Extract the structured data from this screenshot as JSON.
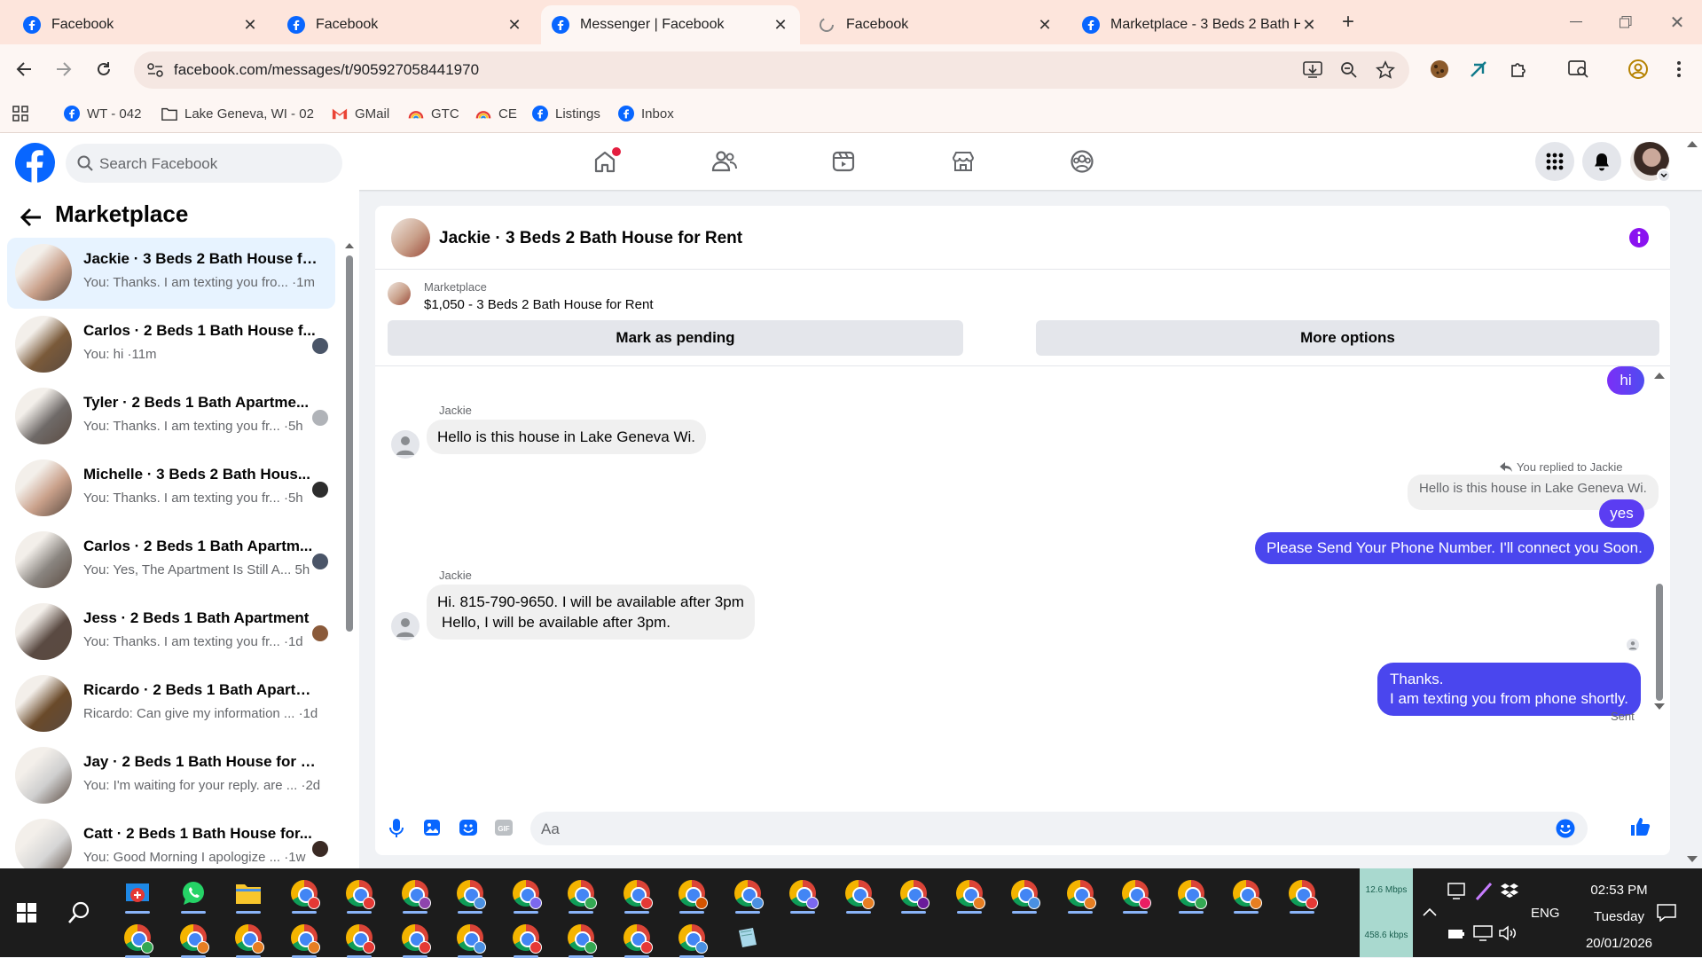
{
  "browser": {
    "tabs": [
      {
        "title": "Facebook",
        "icon": "facebook-icon",
        "active": false
      },
      {
        "title": "Facebook",
        "icon": "facebook-icon",
        "active": false
      },
      {
        "title": "Messenger | Facebook",
        "icon": "facebook-icon",
        "active": true
      },
      {
        "title": "Facebook",
        "icon": "loading-icon",
        "active": false
      },
      {
        "title": "Marketplace - 3 Beds 2 Bath Ho",
        "icon": "facebook-icon",
        "active": false
      }
    ],
    "url": "facebook.com/messages/t/905927058441970",
    "bookmarks": [
      {
        "label": "WT - 042",
        "icon": "facebook-icon"
      },
      {
        "label": "Lake Geneva, WI - 02",
        "icon": "folder-icon"
      },
      {
        "label": "GMail",
        "icon": "gmail-icon"
      },
      {
        "label": "GTC",
        "icon": "rainbow-icon"
      },
      {
        "label": "CE",
        "icon": "rainbow-icon"
      },
      {
        "label": "Listings",
        "icon": "facebook-icon"
      },
      {
        "label": "Inbox",
        "icon": "facebook-icon"
      }
    ]
  },
  "facebook": {
    "search_placeholder": "Search Facebook",
    "brand_color": "#0866ff"
  },
  "sidebar": {
    "title": "Marketplace",
    "conversations": [
      {
        "title": "Jackie · 3 Beds 2 Bath House for...",
        "preview": "You: Thanks. I am texting you fro... ·1m",
        "selected": true,
        "thumb": "#c9a08a"
      },
      {
        "title": "Carlos · 2 Beds 1 Bath House f...",
        "preview": "You: hi ·11m",
        "selected": false,
        "thumb": "#7a5a3a"
      },
      {
        "title": "Tyler · 2 Beds 1 Bath Apartme...",
        "preview": "You: Thanks. I am texting you fr... ·5h",
        "selected": false,
        "thumb": "#6f6a68"
      },
      {
        "title": "Michelle · 3 Beds 2 Bath Hous...",
        "preview": "You: Thanks. I am texting you fr... ·5h",
        "selected": false,
        "thumb": "#c9a08a"
      },
      {
        "title": "Carlos · 2 Beds 1 Bath Apartm...",
        "preview": "You: Yes, The Apartment Is Still A... 5h",
        "selected": false,
        "thumb": "#8a8580"
      },
      {
        "title": "Jess · 2 Beds 1 Bath Apartment",
        "preview": "You: Thanks. I am texting you fr... ·1d",
        "selected": false,
        "thumb": "#5a4a42"
      },
      {
        "title": "Ricardo · 2 Beds 1 Bath Apartme...",
        "preview": "Ricardo: Can give my information ... ·1d",
        "selected": false,
        "thumb": "#6a4a2a"
      },
      {
        "title": "Jay · 2 Beds 1 Bath House for Rent",
        "preview": "You: I'm waiting for your reply. are ... ·2d",
        "selected": false,
        "thumb": "#cfcfcf"
      },
      {
        "title": "Catt · 2 Beds 1 Bath House for...",
        "preview": "You: Good Morning I apologize ... ·1w",
        "selected": false,
        "thumb": "#d6d6d6"
      }
    ]
  },
  "chat": {
    "header_title": "Jackie · 3 Beds 2 Bath House for Rent",
    "listing_label": "Marketplace",
    "listing_price": "$1,050 - 3 Beds 2 Bath House for Rent",
    "mark_pending": "Mark as pending",
    "more_options": "More options",
    "messages": {
      "out_hi": "hi",
      "sender1": "Jackie",
      "in1": "Hello is this house in Lake Geneva Wi.",
      "replied_to": "You replied to Jackie",
      "quoted": "Hello is this house in Lake Geneva Wi.",
      "out_yes": "yes",
      "out_phone": "Please Send Your Phone Number. I'll connect you Soon.",
      "sender2": "Jackie",
      "in2_line1": "Hi. 815-790-9650.  I will be available after 3pm",
      "in2_line2": "Hello, I will be available after 3pm.",
      "out_thanks_line1": "Thanks.",
      "out_thanks_line2": "I am texting you from phone shortly.",
      "status": "Sent"
    },
    "composer_placeholder": "Aa",
    "accent": "#7b2ff7"
  },
  "taskbar": {
    "net_up": "12.6 Mbps",
    "net_down": "458.6 kbps",
    "lang": "ENG",
    "time": "02:53 PM",
    "day": "Tuesday",
    "date": "20/01/2026"
  }
}
